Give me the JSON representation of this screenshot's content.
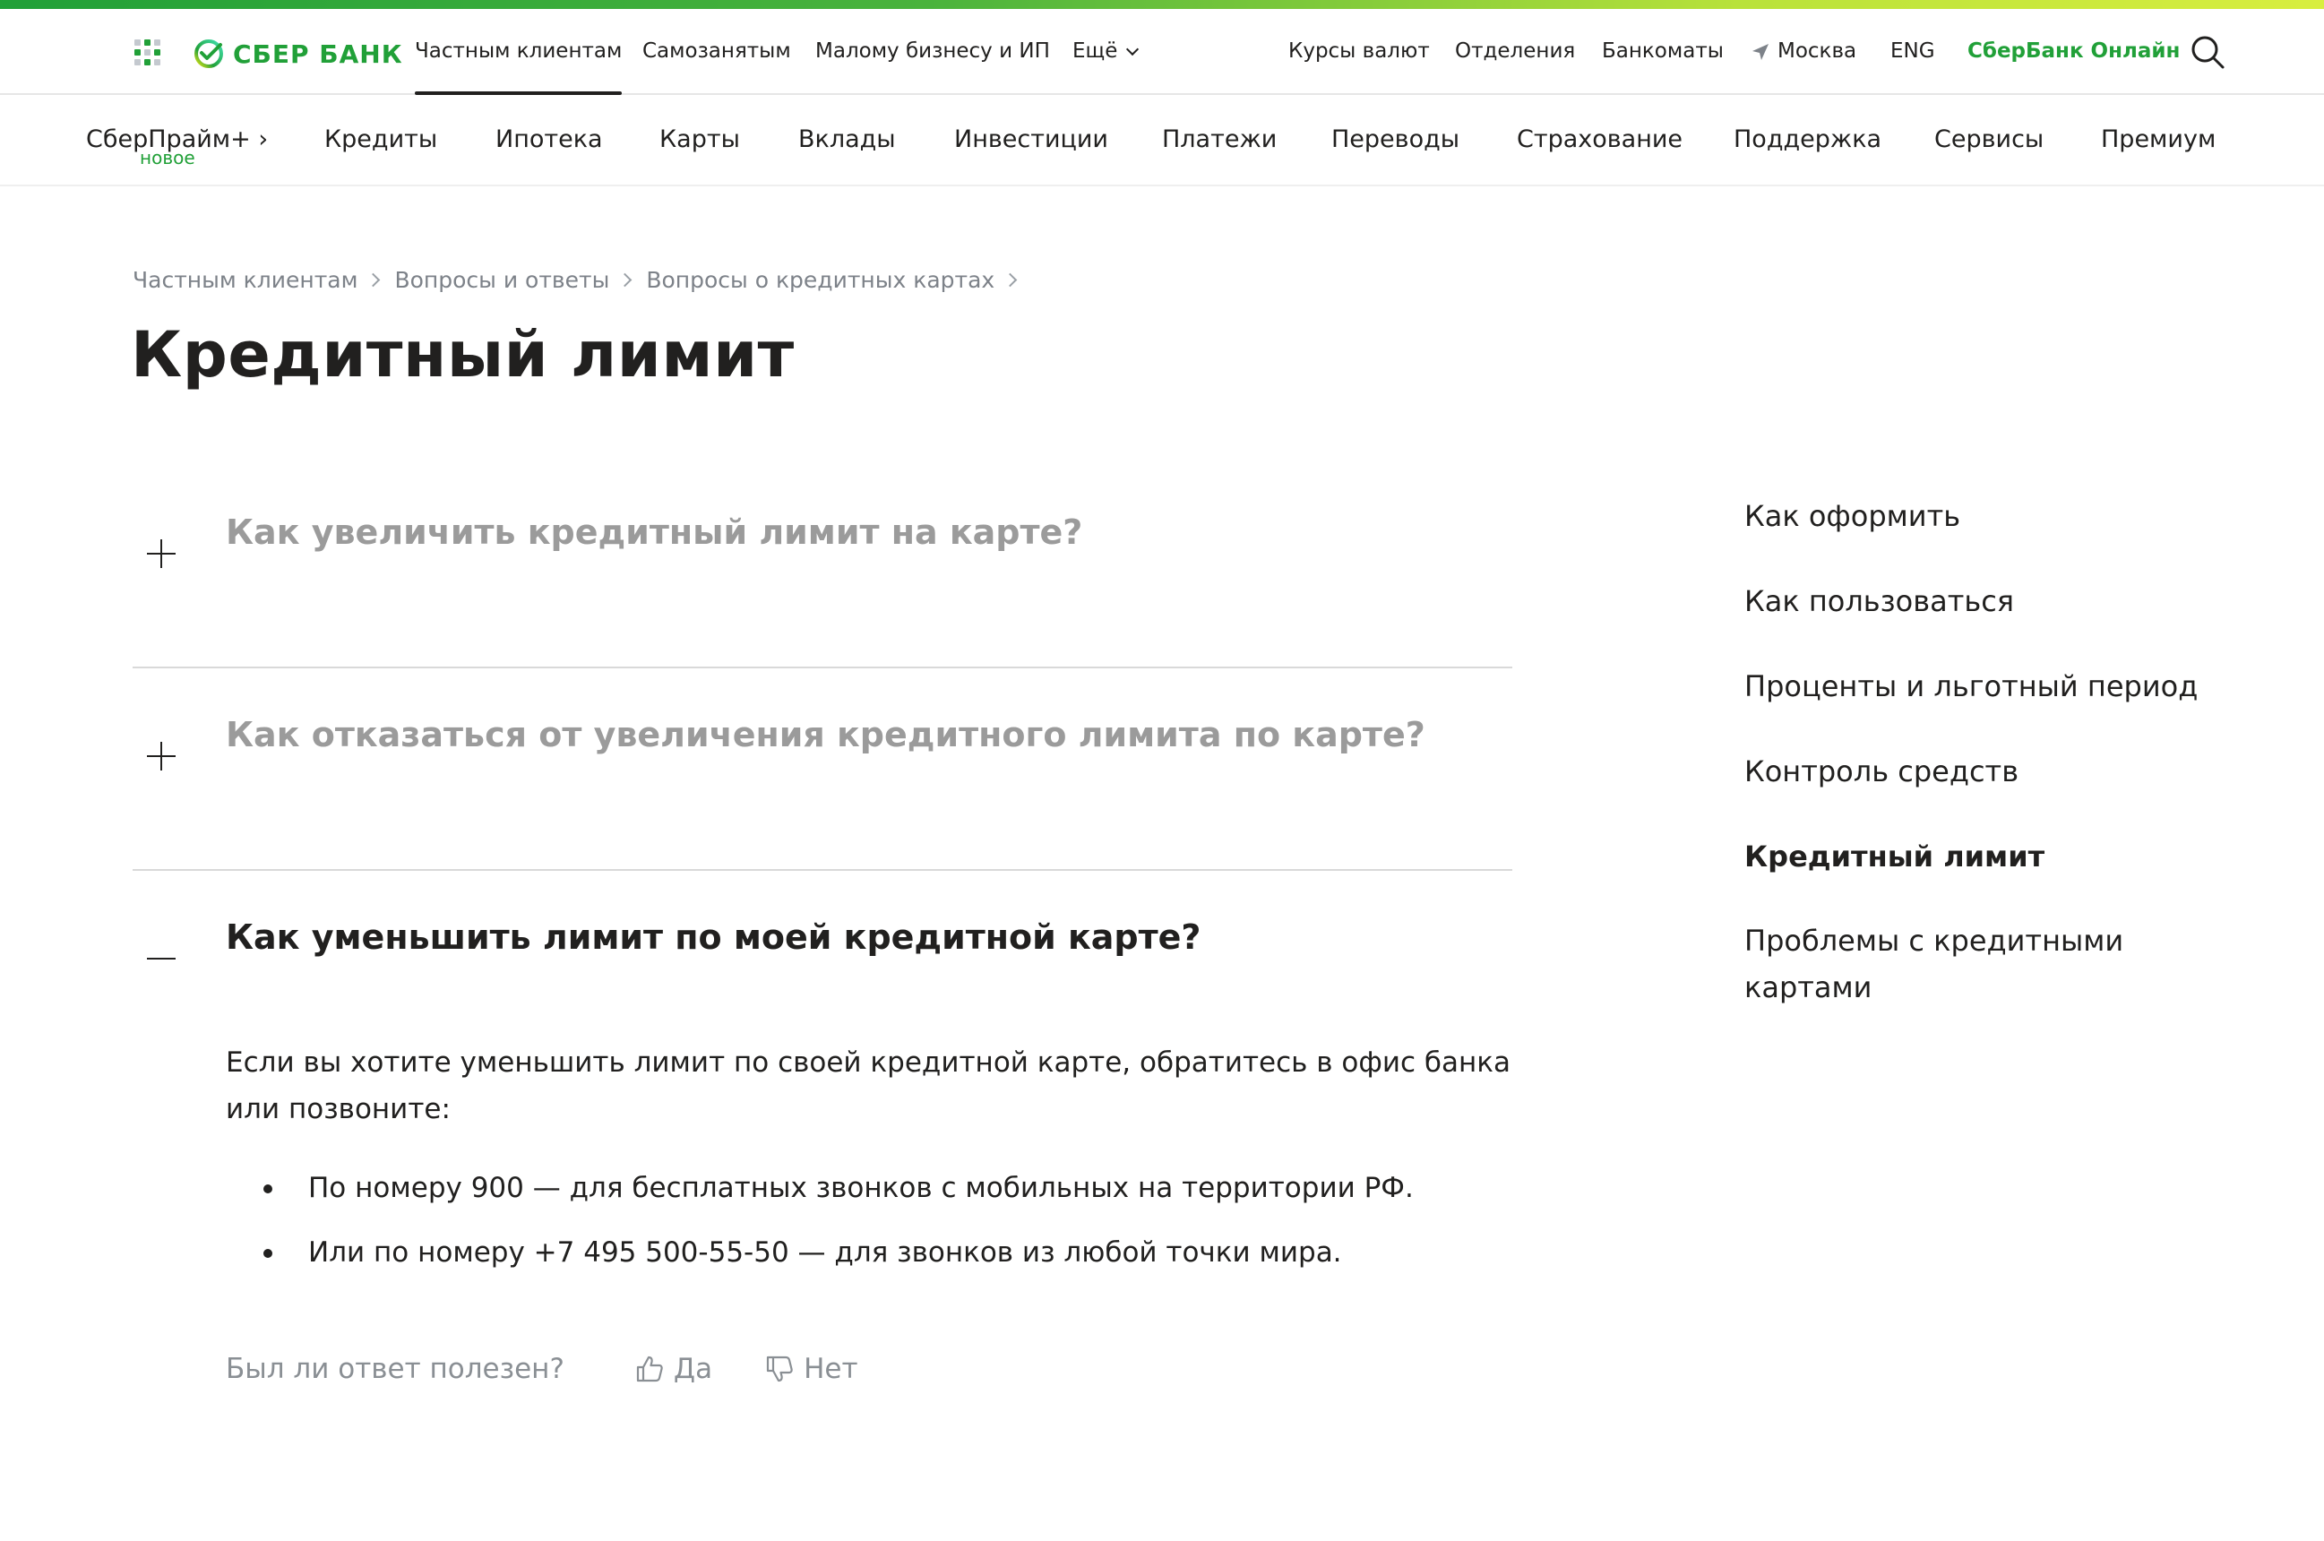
{
  "brand": {
    "logo_text": "СБЕР БАНК",
    "green": "#21a038"
  },
  "topnav": {
    "items": [
      {
        "label": "Частным клиентам",
        "active": true
      },
      {
        "label": "Самозанятым"
      },
      {
        "label": "Малому бизнесу и ИП"
      },
      {
        "label": "Ещё"
      }
    ],
    "right": {
      "rates": "Курсы валют",
      "branches": "Отделения",
      "atms": "Банкоматы",
      "city": "Москва",
      "lang": "ENG",
      "online": "СберБанк Онлайн"
    }
  },
  "mainnav": {
    "prime": "СберПрайм+ ›",
    "prime_badge": "новое",
    "items": [
      "Кредиты",
      "Ипотека",
      "Карты",
      "Вклады",
      "Инвестиции",
      "Платежи",
      "Переводы",
      "Страхование",
      "Поддержка",
      "Сервисы",
      "Премиум"
    ]
  },
  "breadcrumb": [
    "Частным клиентам",
    "Вопросы и ответы",
    "Вопросы о кредитных картах"
  ],
  "page_title": "Кредитный лимит",
  "faq": [
    {
      "question": "Как увеличить кредитный лимит на карте?",
      "open": false
    },
    {
      "question": "Как отказаться от увеличения кредитного лимита по карте?",
      "open": false
    },
    {
      "question": "Как уменьшить лимит по моей кредитной карте?",
      "open": true
    }
  ],
  "answer": {
    "text": "Если вы хотите уменьшить лимит по своей кредитной карте, обратитесь в офис банка или позвоните:",
    "bullets": [
      "По номеру 900 — для бесплатных звонков с мобильных на территории РФ.",
      "Или по номеру +7 495 500-55-50 — для звонков из любой точки мира."
    ]
  },
  "feedback": {
    "question": "Был ли ответ полезен?",
    "yes": "Да",
    "no": "Нет"
  },
  "sidenav": {
    "items": [
      {
        "label": "Как оформить"
      },
      {
        "label": "Как пользоваться"
      },
      {
        "label": "Проценты и льготный период"
      },
      {
        "label": "Контроль средств"
      },
      {
        "label": "Кредитный лимит",
        "active": true
      },
      {
        "label": "Проблемы с кредитными картами"
      }
    ]
  },
  "icons": {
    "apps": "apps-grid-icon",
    "logo": "sber-logo-icon",
    "location": "location-arrow-icon",
    "search": "search-icon",
    "thumb_up": "thumb-up-icon",
    "thumb_down": "thumb-down-icon"
  }
}
